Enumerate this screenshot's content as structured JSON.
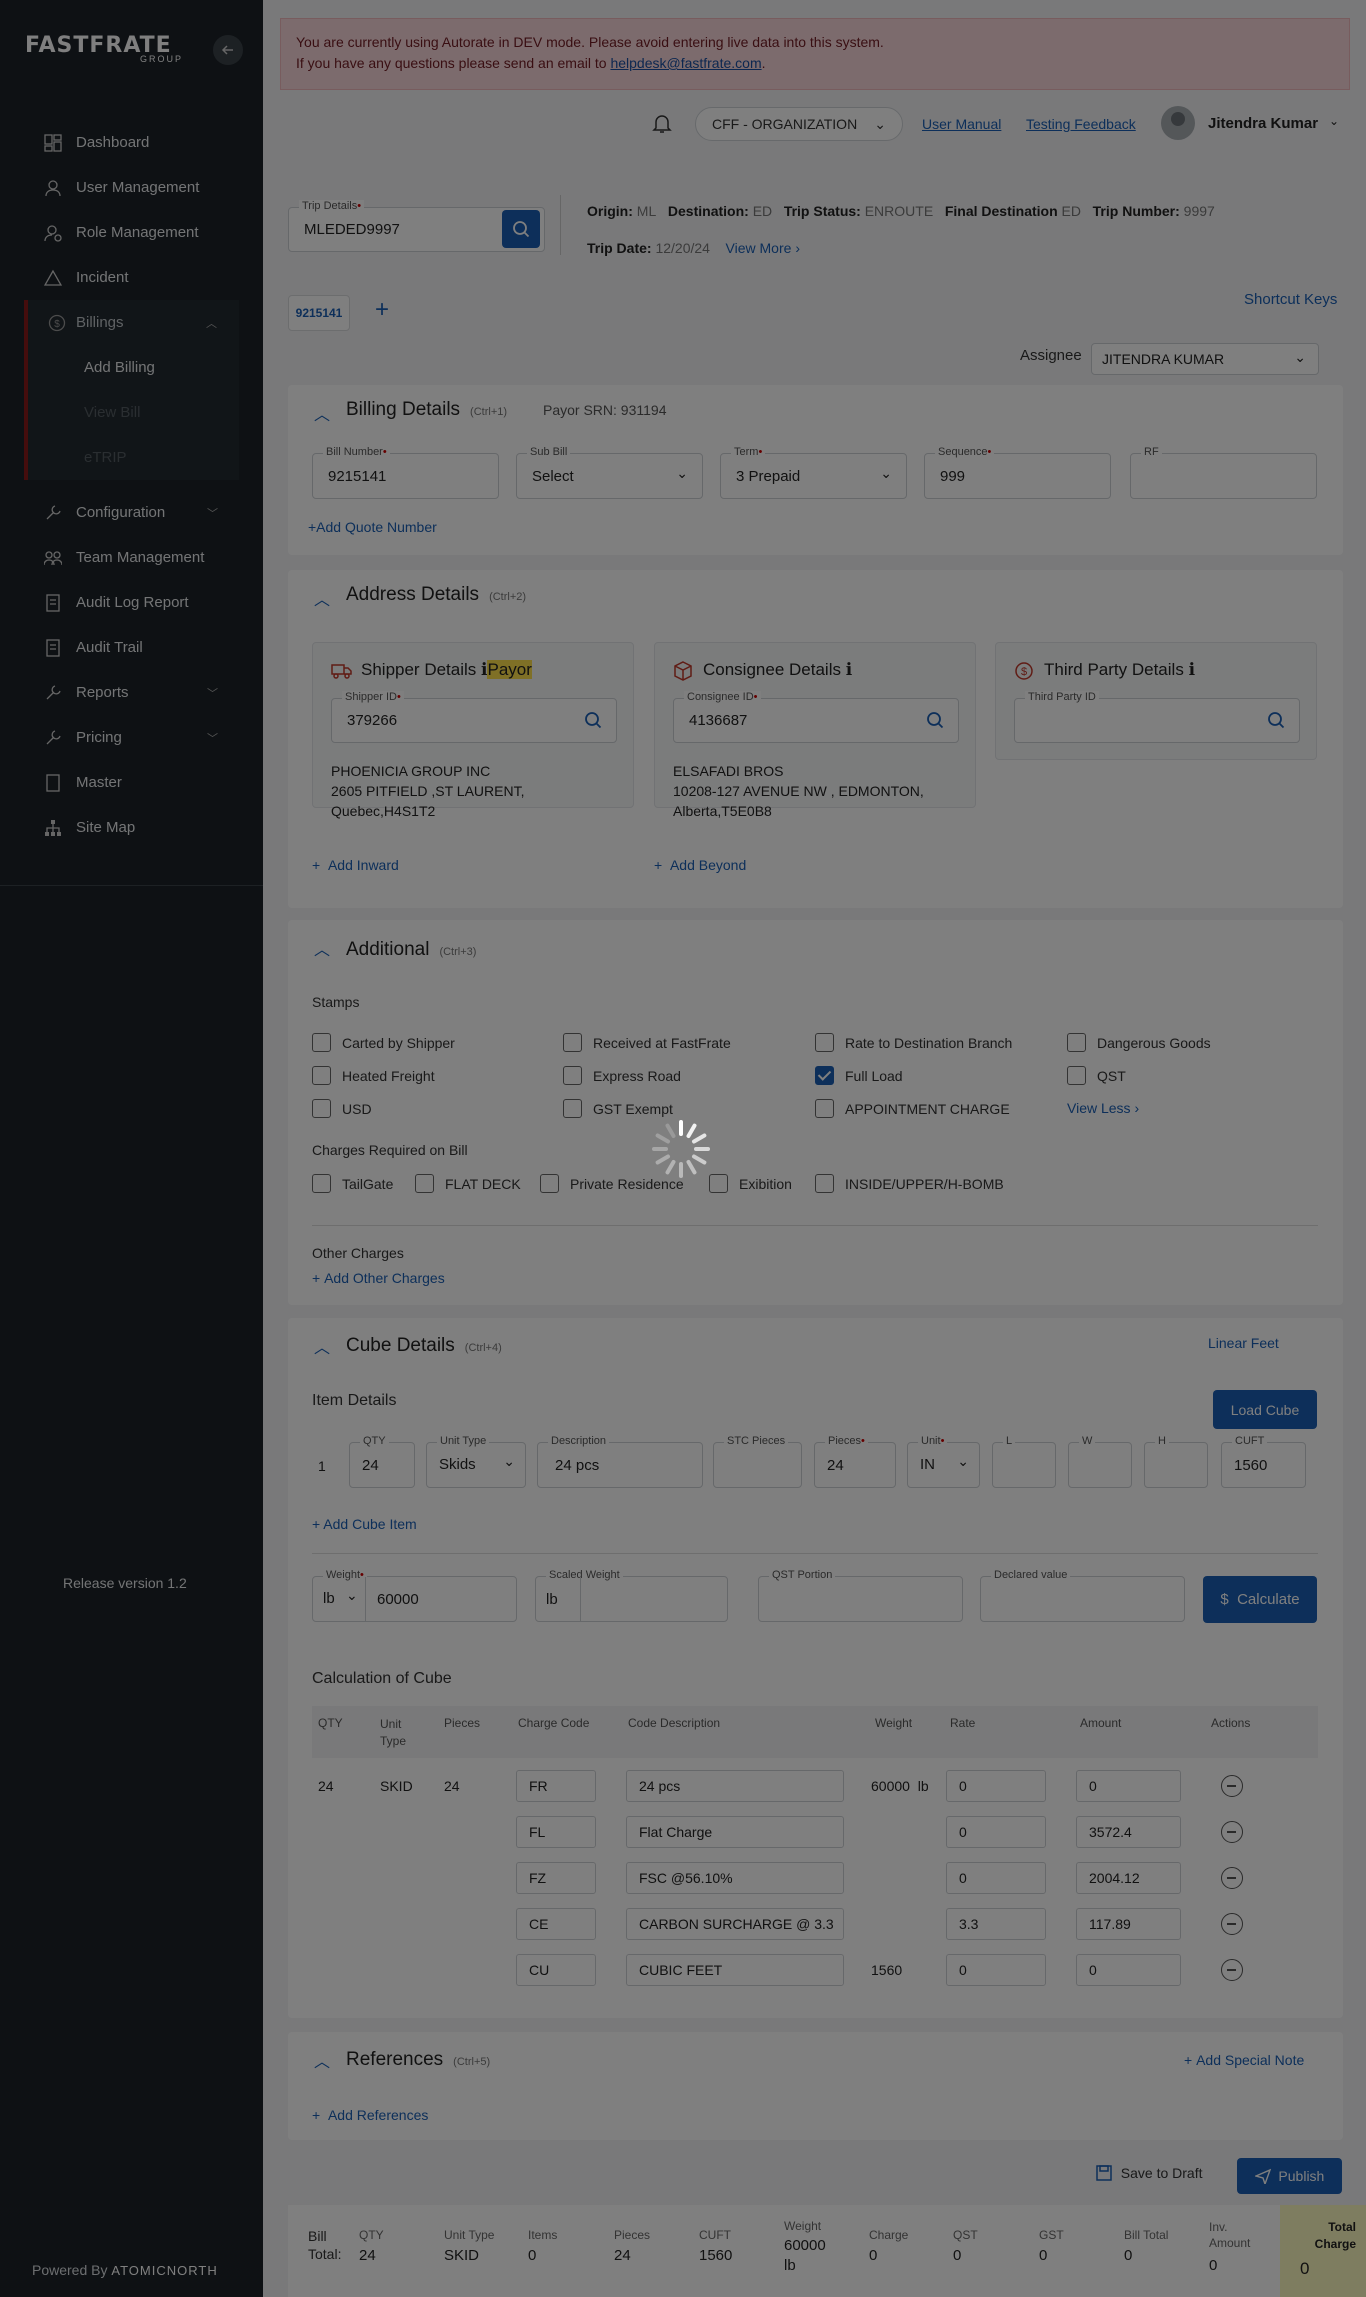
{
  "sidebar": {
    "logo": "FASTFRATE",
    "logo_sub": "GROUP",
    "items": [
      {
        "label": "Dashboard",
        "icon": "dashboard-icon"
      },
      {
        "label": "User Management",
        "icon": "user-icon"
      },
      {
        "label": "Role Management",
        "icon": "role-icon"
      },
      {
        "label": "Incident",
        "icon": "warning-icon"
      }
    ],
    "billings": {
      "label": "Billings",
      "sub": [
        "Add Billing",
        "View Bill",
        "eTRIP"
      ]
    },
    "items2": [
      {
        "label": "Configuration",
        "icon": "wrench-icon",
        "chev": true
      },
      {
        "label": "Team Management",
        "icon": "team-icon",
        "chev": false
      },
      {
        "label": "Audit Log Report",
        "icon": "report-icon",
        "chev": false
      },
      {
        "label": "Audit Trail",
        "icon": "trail-icon",
        "chev": false
      },
      {
        "label": "Reports",
        "icon": "reports-icon",
        "chev": true
      },
      {
        "label": "Pricing",
        "icon": "pricing-icon",
        "chev": true
      },
      {
        "label": "Master",
        "icon": "master-icon",
        "chev": false
      },
      {
        "label": "Site Map",
        "icon": "sitemap-icon",
        "chev": false
      }
    ],
    "release": "Release version 1.2",
    "powered": "Powered By",
    "powered_brand": "ATOMICNORTH"
  },
  "alert": {
    "line1": "You are currently using Autorate in DEV mode. Please avoid entering live data into this system.",
    "line2_pre": "If you have any questions please send an email to ",
    "email": "helpdesk@fastfrate.com",
    "line2_post": "."
  },
  "topbar": {
    "org": "CFF - ORGANIZATION",
    "manual": "User Manual",
    "feedback": "Testing Feedback",
    "user": "Jitendra Kumar"
  },
  "trip": {
    "label": "Trip Details",
    "value": "MLEDED9997",
    "origin_l": "Origin:",
    "origin": "ML",
    "dest_l": "Destination:",
    "dest": "ED",
    "status_l": "Trip Status:",
    "status": "ENROUTE",
    "final_l": "Final Destination",
    "final": "ED",
    "num_l": "Trip Number:",
    "num": "9997",
    "date_l": "Trip Date:",
    "date": "12/20/24",
    "view_more": "View More"
  },
  "tab": {
    "label": "9215141",
    "shortcut": "Shortcut Keys",
    "assignee_l": "Assignee",
    "assignee": "JITENDRA KUMAR"
  },
  "billing": {
    "title": "Billing Details",
    "ctrl": "(Ctrl+1)",
    "payor": "Payor SRN: 931194",
    "bill_l": "Bill Number",
    "bill": "9215141",
    "sub_l": "Sub Bill",
    "sub": "Select",
    "term_l": "Term",
    "term": "3 Prepaid",
    "seq_l": "Sequence",
    "seq": "999",
    "rf_l": "RF",
    "add_quote": "+Add Quote Number"
  },
  "address": {
    "title": "Address Details",
    "ctrl": "(Ctrl+2)",
    "shipper": {
      "title": "Shipper Details",
      "payor": "Payor",
      "id_l": "Shipper ID",
      "id": "379266",
      "name": "PHOENICIA GROUP INC",
      "addr1": "2605 PITFIELD   ,ST LAURENT,",
      "addr2": "Quebec,H4S1T2"
    },
    "consignee": {
      "title": "Consignee Details",
      "id_l": "Consignee ID",
      "id": "4136687",
      "name": "ELSAFADI BROS",
      "addr1": "10208-127 AVENUE NW   , EDMONTON,",
      "addr2": "Alberta,T5E0B8"
    },
    "third": {
      "title": "Third Party Details",
      "id_l": "Third Party ID"
    },
    "add_inward": "Add Inward",
    "add_beyond": "Add Beyond"
  },
  "additional": {
    "title": "Additional",
    "ctrl": "(Ctrl+3)",
    "stamps": "Stamps",
    "stamp_list": [
      [
        "Carted by Shipper",
        false
      ],
      [
        "Received at FastFrate",
        false
      ],
      [
        "Rate to Destination Branch",
        false
      ],
      [
        "Dangerous Goods",
        false
      ],
      [
        "Heated Freight",
        false
      ],
      [
        "Express Road",
        false
      ],
      [
        "Full Load",
        true
      ],
      [
        "QST",
        false
      ],
      [
        "USD",
        false
      ],
      [
        "GST Exempt",
        false
      ],
      [
        "APPOINTMENT CHARGE",
        false
      ]
    ],
    "view_less": "View Less",
    "charges_req": "Charges Required on Bill",
    "charges": [
      "TailGate",
      "FLAT DECK",
      "Private Residence",
      "Exibition",
      "INSIDE/UPPER/H-BOMB"
    ],
    "other": "Other Charges",
    "add_other": "Add Other Charges"
  },
  "cube": {
    "title": "Cube Details",
    "ctrl": "(Ctrl+4)",
    "linear": "Linear Feet",
    "item_details": "Item Details",
    "load_cube": "Load Cube",
    "row": {
      "idx": "1",
      "qty_l": "QTY",
      "qty": "24",
      "unit_type_l": "Unit Type",
      "unit_type": "Skids",
      "desc_l": "Description",
      "desc": "24 pcs",
      "stc_l": "STC Pieces",
      "pieces_l": "Pieces",
      "pieces": "24",
      "unit_l": "Unit",
      "unit": "IN",
      "l": "L",
      "w": "W",
      "h": "H",
      "cuft_l": "CUFT",
      "cuft": "1560"
    },
    "add_item": "+ Add Cube Item",
    "weight_l": "Weight",
    "weight_unit": "lb",
    "weight": "60000",
    "scaled_l": "Scaled Weight",
    "scaled_unit": "lb",
    "qst_l": "QST Portion",
    "declared_l": "Declared value",
    "calculate": "Calculate",
    "calc_title": "Calculation of Cube",
    "headers": [
      "QTY",
      "Unit Type",
      "Pieces",
      "Charge Code",
      "Code Description",
      "Weight",
      "Rate",
      "Amount",
      "Actions"
    ],
    "rows": [
      {
        "qty": "24",
        "unit": "SKID",
        "pieces": "24",
        "code": "FR",
        "desc": "24 pcs",
        "weight": "60000",
        "wu": "lb",
        "rate": "0",
        "amount": "0"
      },
      {
        "qty": "",
        "unit": "",
        "pieces": "",
        "code": "FL",
        "desc": "Flat Charge",
        "weight": "",
        "wu": "",
        "rate": "0",
        "amount": "3572.4"
      },
      {
        "qty": "",
        "unit": "",
        "pieces": "",
        "code": "FZ",
        "desc": "FSC @56.10%",
        "weight": "",
        "wu": "",
        "rate": "0",
        "amount": "2004.12"
      },
      {
        "qty": "",
        "unit": "",
        "pieces": "",
        "code": "CE",
        "desc": "CARBON SURCHARGE @ 3.3",
        "weight": "",
        "wu": "",
        "rate": "3.3",
        "amount": "117.89"
      },
      {
        "qty": "",
        "unit": "",
        "pieces": "",
        "code": "CU",
        "desc": "CUBIC FEET",
        "weight": "1560",
        "wu": "",
        "rate": "0",
        "amount": "0"
      }
    ]
  },
  "references": {
    "title": "References",
    "ctrl": "(Ctrl+5)",
    "special": "Add Special Note",
    "add": "Add References"
  },
  "actions": {
    "draft": "Save to Draft",
    "publish": "Publish"
  },
  "totals": {
    "bill_total": "Bill Total:",
    "qty_l": "QTY",
    "qty": "24",
    "unit_l": "Unit Type",
    "unit": "SKID",
    "items_l": "Items",
    "items": "0",
    "pieces_l": "Pieces",
    "pieces": "24",
    "cuft_l": "CUFT",
    "cuft": "1560",
    "weight_l": "Weight",
    "weight": "60000",
    "weight_u": "lb",
    "charge_l": "Charge",
    "charge": "0",
    "qst_l": "QST",
    "qst": "0",
    "gst_l": "GST",
    "gst": "0",
    "billtot_l": "Bill Total",
    "billtot": "0",
    "inv_l": "Inv. Amount",
    "inv": "0",
    "total_l": "Total Charge",
    "total": "0"
  }
}
